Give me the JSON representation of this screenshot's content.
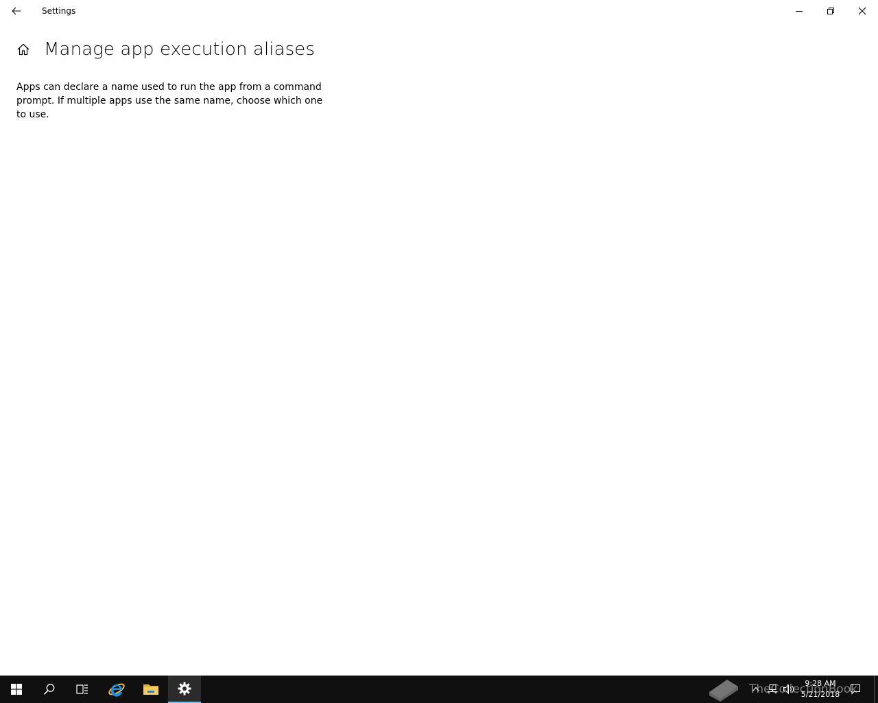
{
  "window": {
    "title": "Settings"
  },
  "page": {
    "title": "Manage app execution aliases",
    "description": "Apps can declare a name used to run the app from a command prompt. If multiple apps use the same name, choose which one to use."
  },
  "taskbar": {
    "items": [
      "start-icon",
      "search-icon",
      "task-view-icon",
      "internet-explorer-icon",
      "file-explorer-icon",
      "settings-icon"
    ],
    "active": "settings-icon",
    "accent": "#76b9ed",
    "background": "#101010"
  },
  "tray": {
    "time": "9:28 AM",
    "date": "5/21/2018"
  },
  "watermark": {
    "text": "TheCollectionBook"
  }
}
